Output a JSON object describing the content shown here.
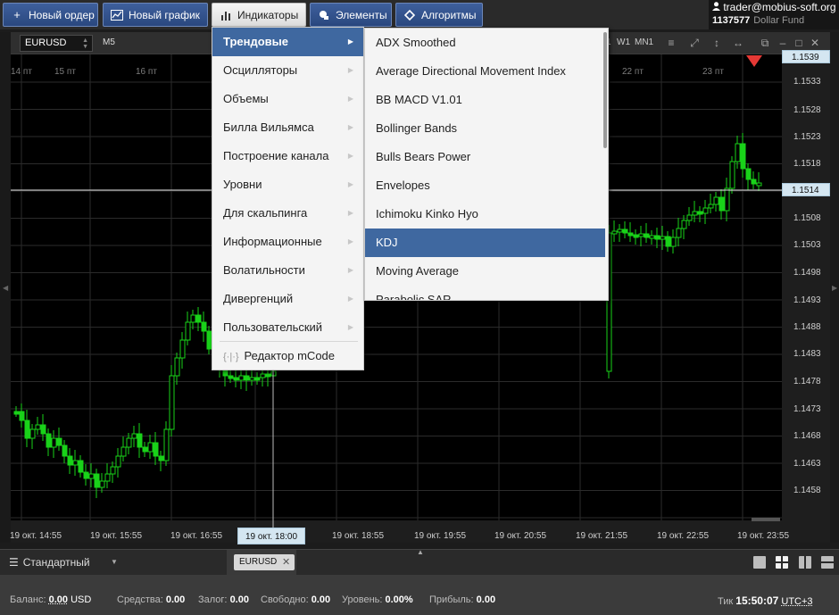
{
  "toolbar": {
    "new_order": "Новый ордер",
    "new_chart": "Новый график",
    "indicators": "Индикаторы",
    "elements": "Элементы",
    "algorithms": "Алгоритмы"
  },
  "account": {
    "email": "trader@mobius-soft.org",
    "id": "1137577",
    "fund": "Dollar Fund"
  },
  "chart": {
    "symbol": "EURUSD",
    "timeframe": "M5",
    "timeframes": [
      "1",
      "W1",
      "MN1"
    ],
    "day_labels": [
      "14 пт",
      "15 пт",
      "16 пт",
      "22 пт",
      "23 пт"
    ],
    "price_labels": [
      "1.1533",
      "1.1528",
      "1.1523",
      "1.1518",
      "1.1508",
      "1.1503",
      "1.1498",
      "1.1493",
      "1.1488",
      "1.1483",
      "1.1478",
      "1.1473",
      "1.1468",
      "1.1463",
      "1.1458"
    ],
    "top_price_tag": "1.1539",
    "current_price": "1.1514",
    "time_labels": [
      "19 окт. 14:55",
      "19 окт. 15:55",
      "19 окт. 16:55",
      "19 окт. 18:55",
      "19 окт. 19:55",
      "19 окт. 20:55",
      "19 окт. 21:55",
      "19 окт. 22:55",
      "19 окт. 23:55"
    ],
    "crosshair_time": "19 окт. 18:00",
    "colors": {
      "bull": "#19d219",
      "bear": "#19d219",
      "background": "#000000",
      "grid": "#2b2b2b",
      "price_line": "#e6e6e6",
      "marker": "#e53935"
    }
  },
  "menu": {
    "categories": [
      "Трендовые",
      "Осцилляторы",
      "Объемы",
      "Билла Вильямса",
      "Построение канала",
      "Уровни",
      "Для скальпинга",
      "Информационные",
      "Волатильности",
      "Дивергенций",
      "Пользовательский"
    ],
    "editor": "Редактор mCode",
    "indicators": [
      "ADX Smoothed",
      "Average Directional Movement Index",
      "BB MACD V1.01",
      "Bollinger Bands",
      "Bulls Bears Power",
      "Envelopes",
      "Ichimoku Kinko Hyo",
      "KDJ",
      "Moving Average",
      "Parabolic SAR"
    ]
  },
  "tabbar": {
    "layout": "Стандартный",
    "tab": "EURUSD"
  },
  "status": {
    "balance_label": "Баланс:",
    "balance": "0.00",
    "currency": "USD",
    "funds_label": "Средства:",
    "funds": "0.00",
    "margin_label": "Залог:",
    "margin": "0.00",
    "free_label": "Свободно:",
    "free": "0.00",
    "level_label": "Уровень:",
    "level": "0.00%",
    "profit_label": "Прибыль:",
    "profit": "0.00",
    "tick_label": "Тик",
    "tick_time": "15:50:07",
    "timezone": "UTC+3"
  }
}
